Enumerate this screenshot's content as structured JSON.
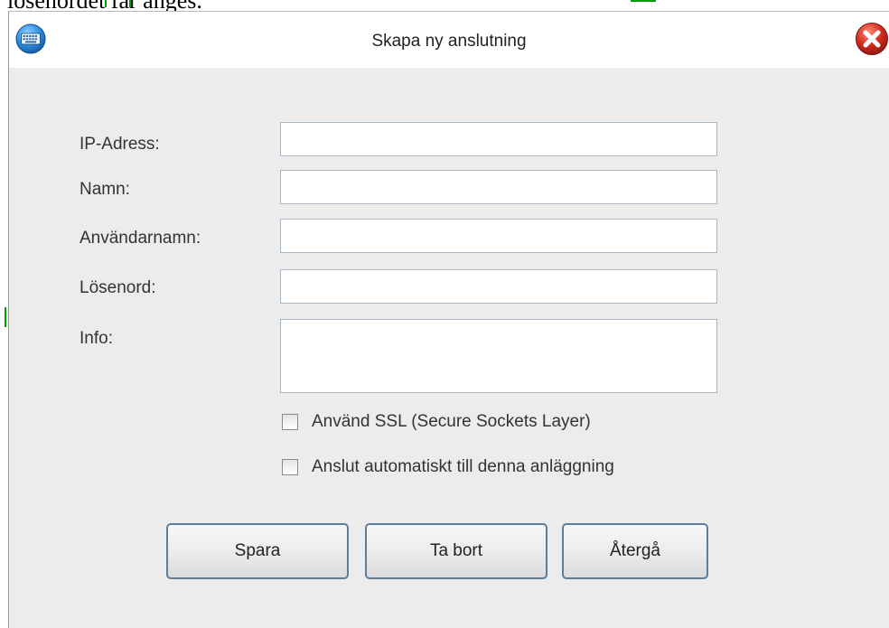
{
  "background": {
    "partial_text": "lösenordet får anges."
  },
  "window": {
    "title": "Skapa ny anslutning",
    "left_icon": "keyboard-icon",
    "right_icon": "close-icon"
  },
  "form": {
    "fields": [
      {
        "label": "IP-Adress:",
        "value": "",
        "placeholder": ""
      },
      {
        "label": "Namn:",
        "value": "",
        "placeholder": ""
      },
      {
        "label": "Användarnamn:",
        "value": "",
        "placeholder": ""
      },
      {
        "label": "Lösenord:",
        "value": "",
        "placeholder": ""
      },
      {
        "label": "Info:",
        "value": "",
        "placeholder": ""
      }
    ],
    "checkboxes": [
      {
        "label": "Använd SSL (Secure Sockets Layer)",
        "checked": false
      },
      {
        "label": "Anslut automatiskt till denna anläggning",
        "checked": false
      }
    ]
  },
  "buttons": {
    "save": "Spara",
    "delete": "Ta bort",
    "back": "Återgå"
  },
  "colors": {
    "dialog_bg": "#ececec",
    "input_border": "#a7b5c5",
    "button_border": "#5e7d9b",
    "close_red": "#d22a20"
  }
}
